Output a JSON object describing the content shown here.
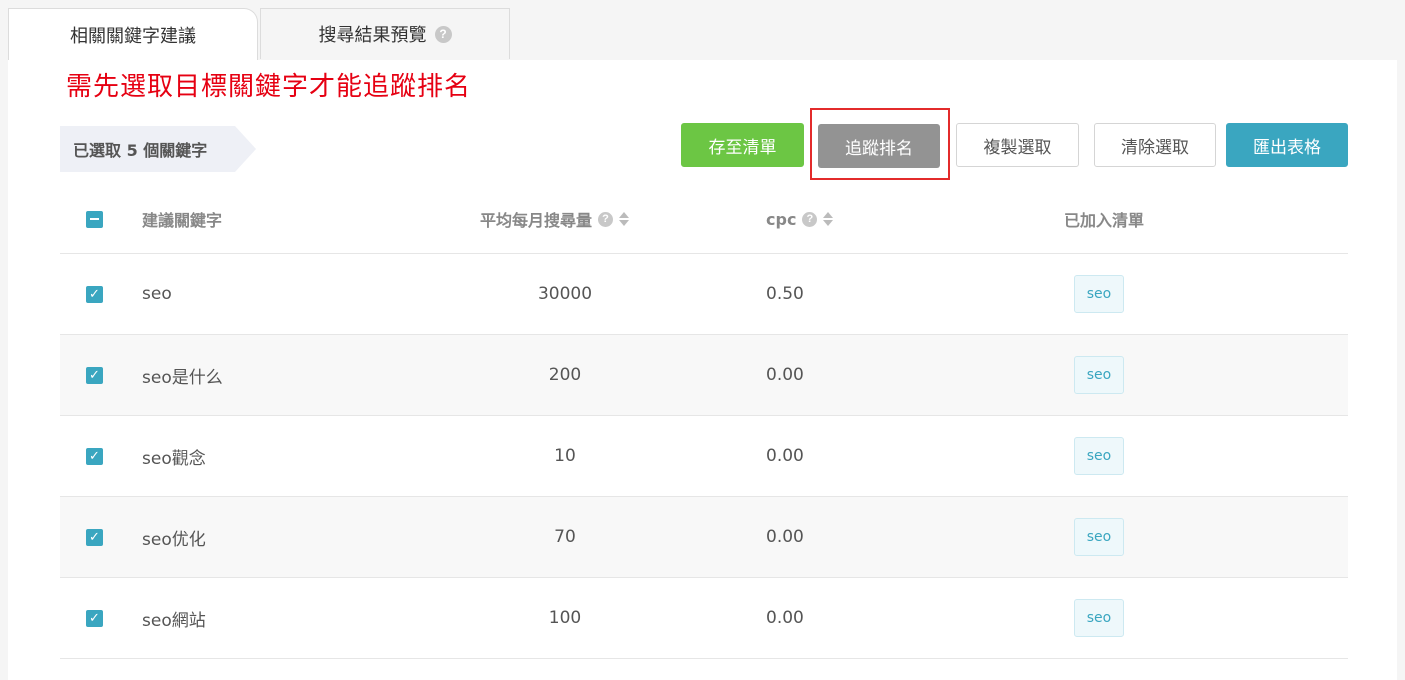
{
  "tabs": [
    {
      "label": "相關關鍵字建議",
      "active": true
    },
    {
      "label": "搜尋結果預覽",
      "active": false,
      "help_icon": "question-circle-icon"
    }
  ],
  "notice": "需先選取目標關鍵字才能追蹤排名",
  "selection": {
    "text": "已選取 5 個關鍵字"
  },
  "toolbar": {
    "save_label": "存至清單",
    "track_label": "追蹤排名",
    "copy_label": "複製選取",
    "clear_label": "清除選取",
    "export_label": "匯出表格"
  },
  "table": {
    "headers": {
      "keyword": "建議關鍵字",
      "volume": "平均每月搜尋量",
      "cpc": "cpc",
      "list": "已加入清單"
    },
    "rows": [
      {
        "keyword": "seo",
        "volume": "30000",
        "cpc": "0.50",
        "list": "seo",
        "checked": true
      },
      {
        "keyword": "seo是什么",
        "volume": "200",
        "cpc": "0.00",
        "list": "seo",
        "checked": true
      },
      {
        "keyword": "seo觀念",
        "volume": "10",
        "cpc": "0.00",
        "list": "seo",
        "checked": true
      },
      {
        "keyword": "seo优化",
        "volume": "70",
        "cpc": "0.00",
        "list": "seo",
        "checked": true
      },
      {
        "keyword": "seo網站",
        "volume": "100",
        "cpc": "0.00",
        "list": "seo",
        "checked": true
      }
    ]
  },
  "colors": {
    "accent": "#3aa6c0",
    "save": "#6cc644",
    "track": "#939393",
    "notice": "#e60012",
    "highlight": "#e32b2b"
  }
}
